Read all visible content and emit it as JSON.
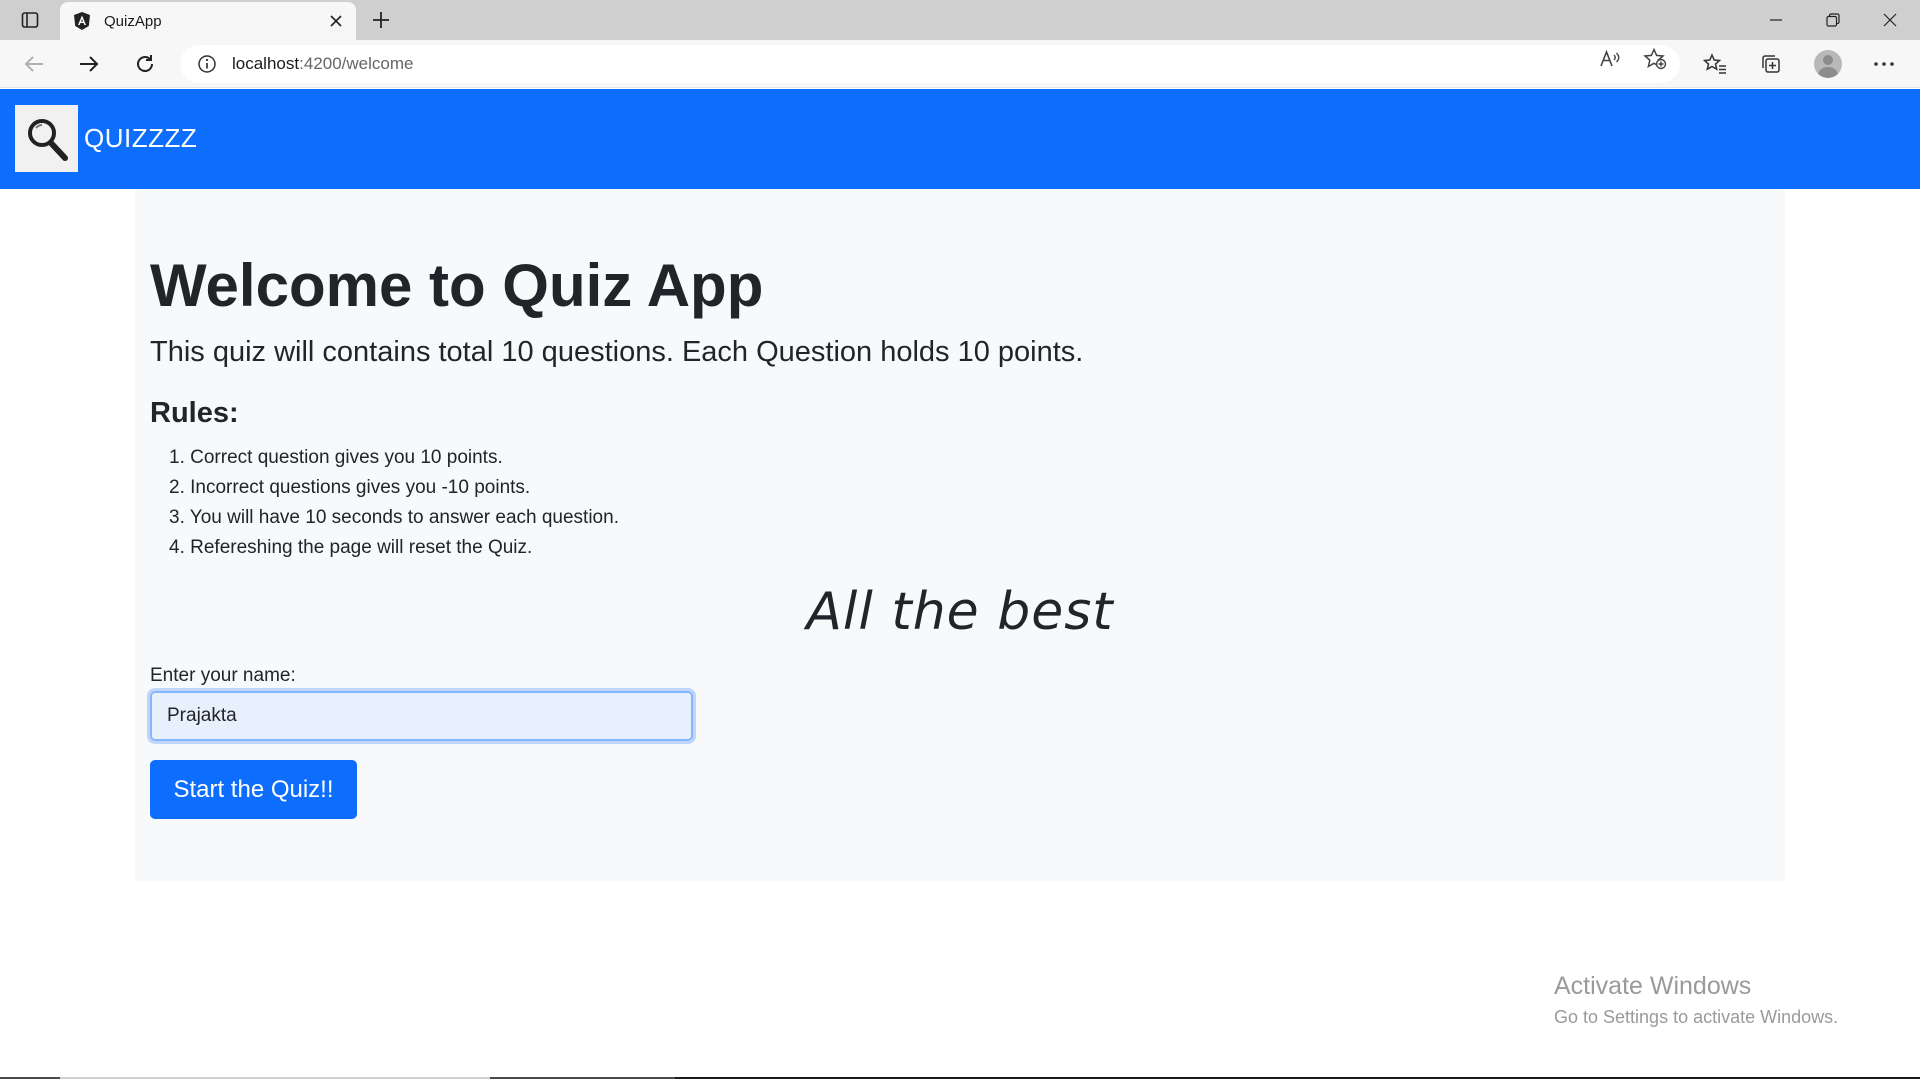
{
  "browser": {
    "tab_title": "QuizApp",
    "url_host": "localhost",
    "url_path": ":4200/welcome"
  },
  "navbar": {
    "brand_name": "QUIZZZZ",
    "logo_icon": "magnifier-icon"
  },
  "welcome": {
    "title": "Welcome to Quiz App",
    "lead": "This quiz will contains total 10 questions. Each Question holds 10 points.",
    "rules_title": "Rules:",
    "rules": [
      "1. Correct question gives you 10 points.",
      "2. Incorrect questions gives you -10 points.",
      "3. You will have 10 seconds to answer each question.",
      "4. Refereshing the page will reset the Quiz."
    ],
    "wish": "All the best",
    "name_label": "Enter your name:",
    "name_value": "Prajakta",
    "start_button": "Start the Quiz!!"
  },
  "watermark": {
    "title": "Activate Windows",
    "subtitle": "Go to Settings to activate Windows."
  },
  "colors": {
    "primary": "#0d6efd",
    "panel_bg": "#f8f9fa",
    "text": "#212529"
  }
}
